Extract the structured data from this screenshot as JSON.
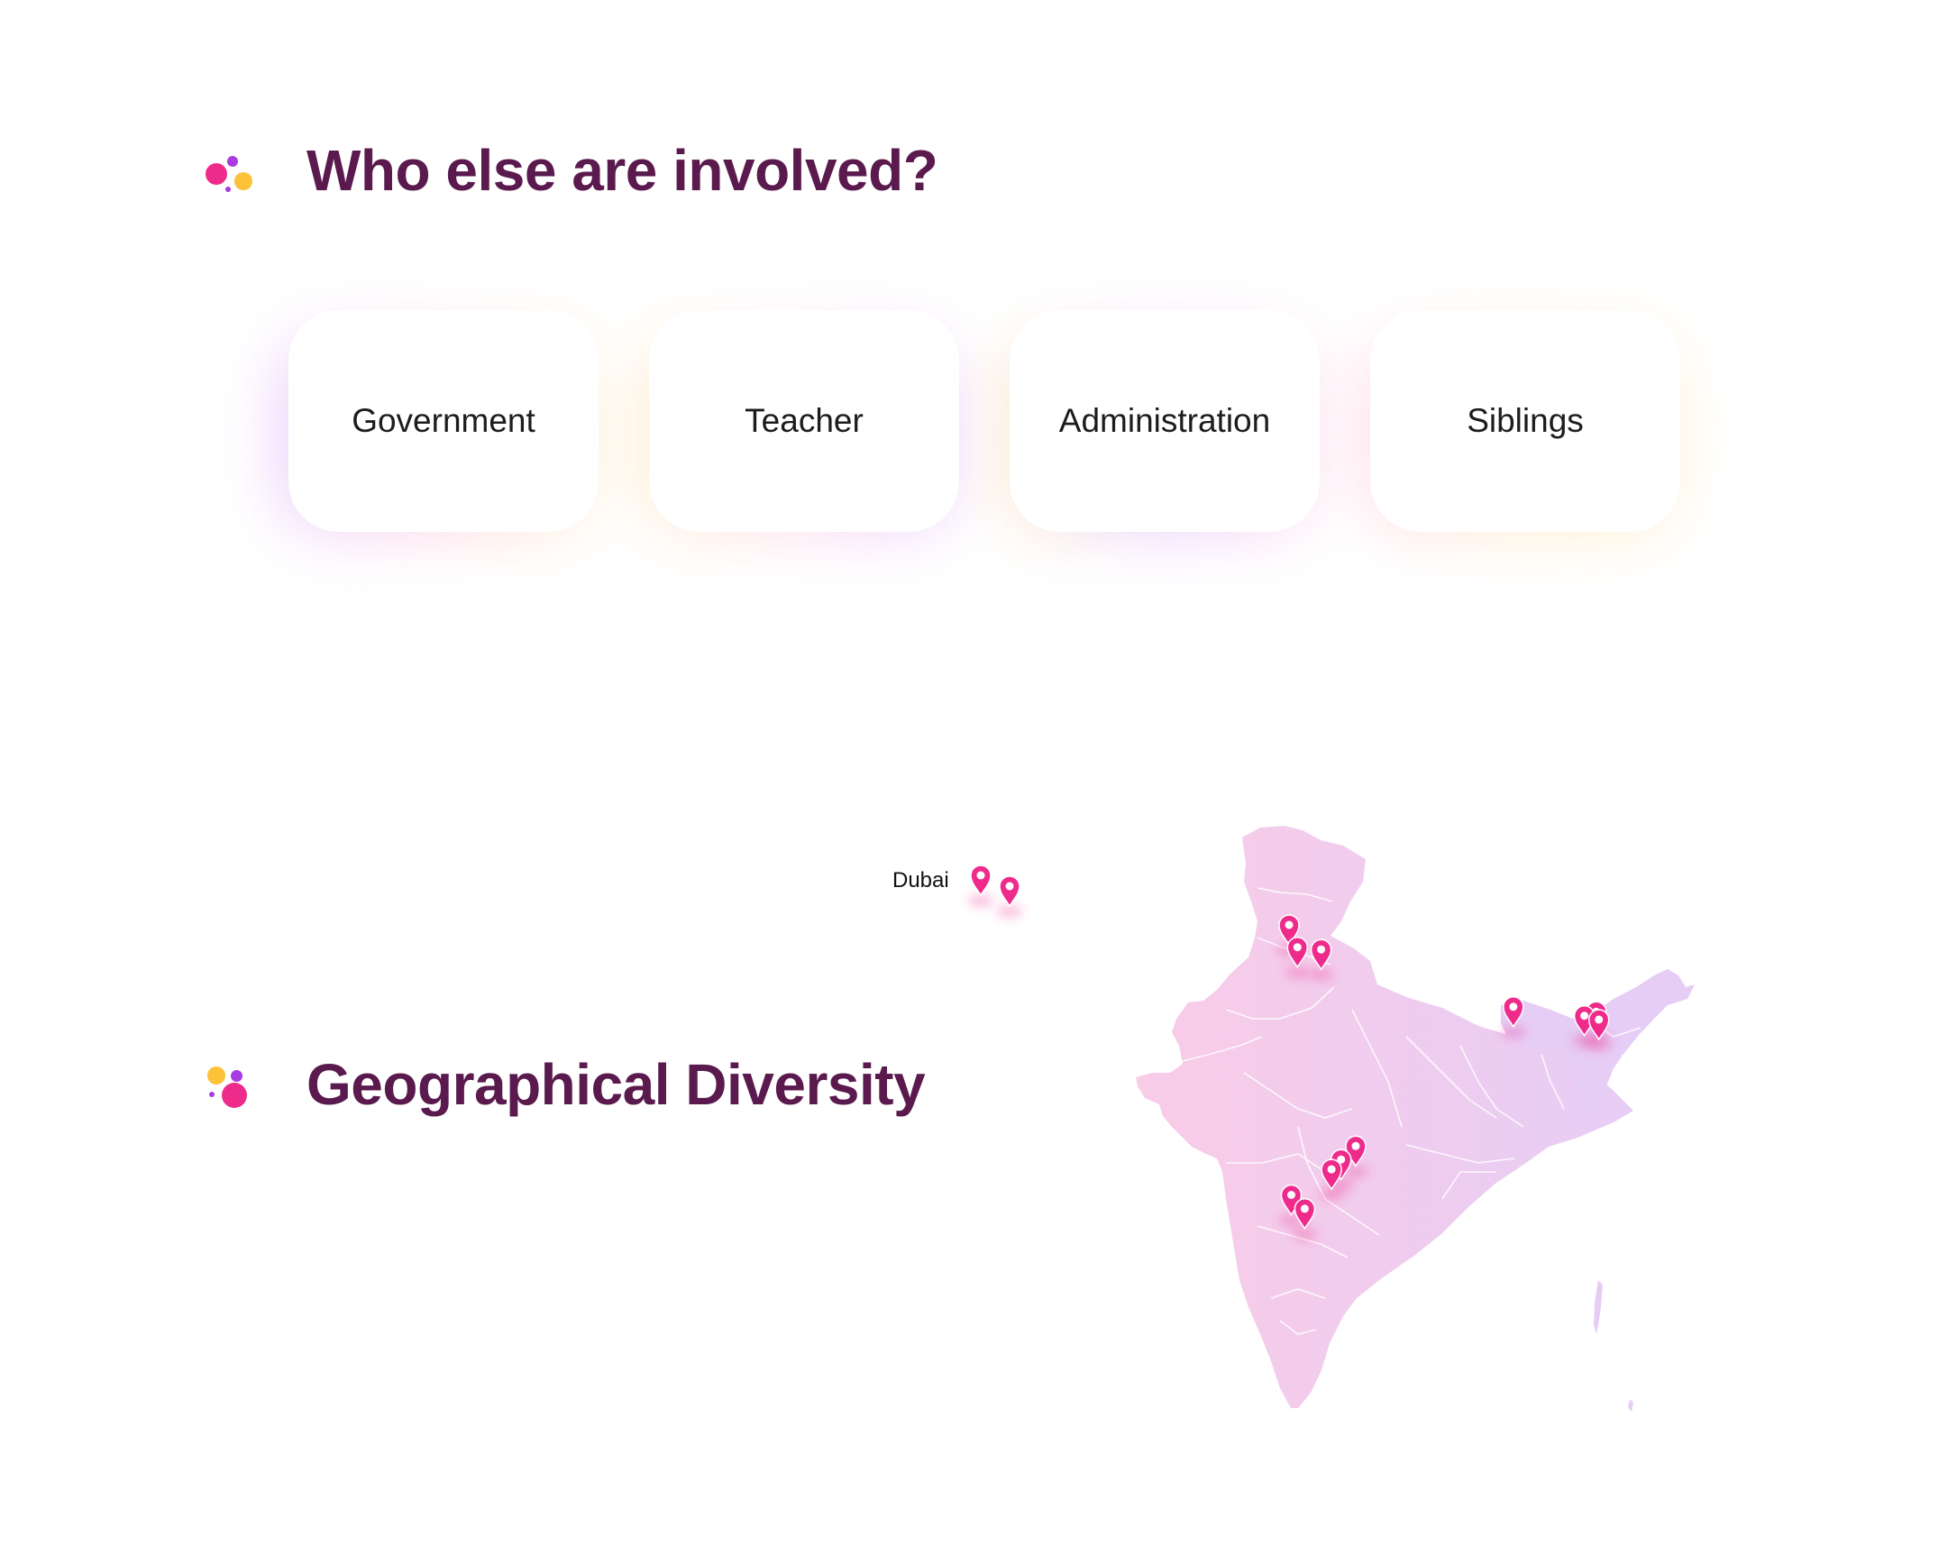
{
  "colors": {
    "title": "#5a1a4e",
    "pin": "#ee2b8b",
    "map_left": "#f9cce7",
    "map_right": "#e6cdf6",
    "dot_pink": "#ee2b8b",
    "dot_purple": "#a83ce0",
    "dot_yellow": "#fbc23a"
  },
  "involved": {
    "title": "Who else are involved?",
    "cards": [
      {
        "label": "Government"
      },
      {
        "label": "Teacher"
      },
      {
        "label": "Administration"
      },
      {
        "label": "Siblings"
      }
    ]
  },
  "geography": {
    "title": "Geographical Diversity",
    "map": {
      "region": "India",
      "icon": "map-pin-icon",
      "external_labels": [
        "Dubai"
      ],
      "pins": [
        {
          "place": "Dubai",
          "lat": 25.2,
          "lon": 55.27
        },
        {
          "place": "Dubai",
          "lat": 24.6,
          "lon": 55.75
        },
        {
          "place": "",
          "lat": 30.7,
          "lon": 76.78
        },
        {
          "place": "",
          "lat": 28.7,
          "lon": 77.1
        },
        {
          "place": "",
          "lat": 28.5,
          "lon": 78.0
        },
        {
          "place": "",
          "lat": 23.35,
          "lon": 85.3
        },
        {
          "place": "",
          "lat": 22.9,
          "lon": 88.45
        },
        {
          "place": "",
          "lat": 22.55,
          "lon": 88.0
        },
        {
          "place": "",
          "lat": 22.2,
          "lon": 88.55
        },
        {
          "place": "",
          "lat": 13.08,
          "lon": 80.27
        },
        {
          "place": "",
          "lat": 12.4,
          "lon": 79.5
        },
        {
          "place": "",
          "lat": 11.9,
          "lon": 79.0
        },
        {
          "place": "",
          "lat": 10.6,
          "lon": 76.9
        },
        {
          "place": "",
          "lat": 9.9,
          "lon": 77.6
        }
      ]
    }
  }
}
